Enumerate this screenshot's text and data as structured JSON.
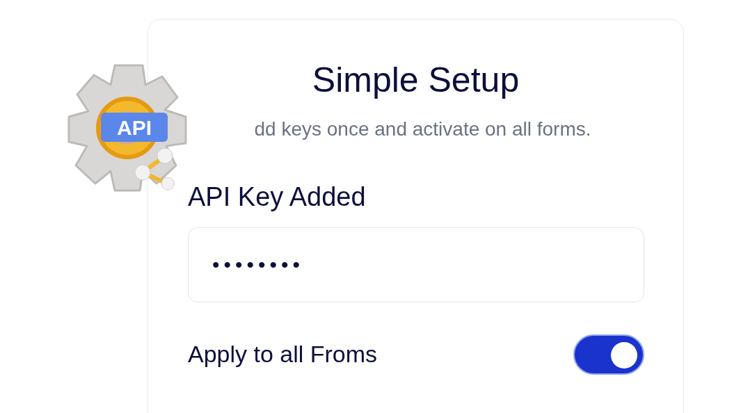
{
  "badge": {
    "text": "API"
  },
  "card": {
    "title": "Simple Setup",
    "subtitle": "dd keys once and activate on all forms."
  },
  "api_key": {
    "label": "API Key Added",
    "value": "••••••••"
  },
  "toggle": {
    "label": "Apply to all Froms",
    "on": true
  }
}
